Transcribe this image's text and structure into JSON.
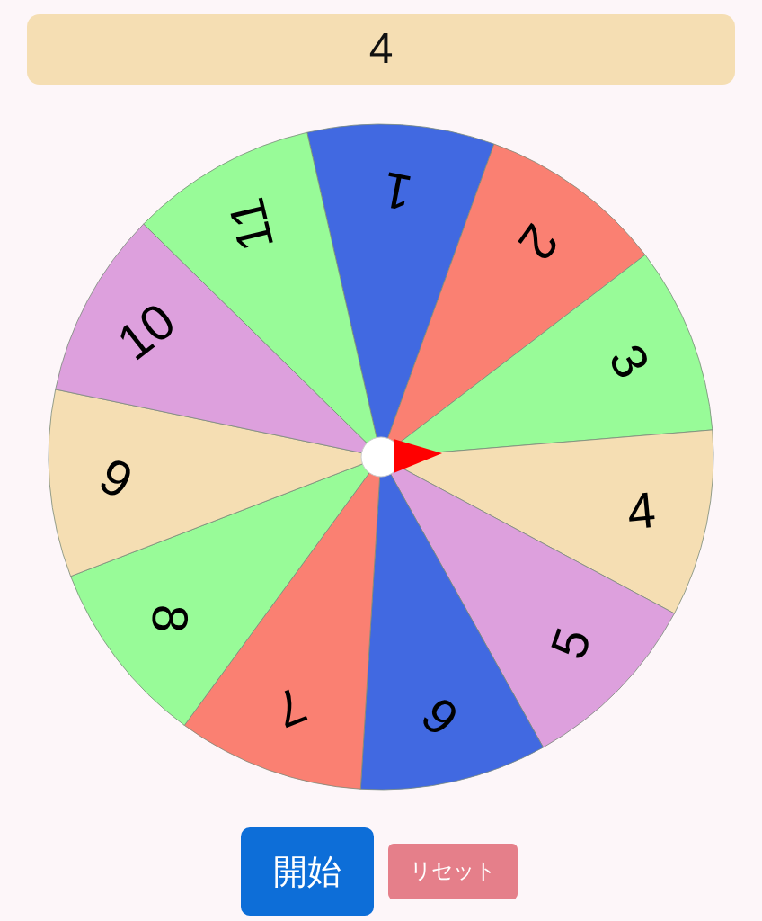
{
  "result": {
    "value": "4"
  },
  "wheel": {
    "segments": [
      {
        "label": "1",
        "color": "#4169e1"
      },
      {
        "label": "2",
        "color": "#fa8072"
      },
      {
        "label": "3",
        "color": "#98fb98"
      },
      {
        "label": "4",
        "color": "#f5deb3"
      },
      {
        "label": "5",
        "color": "#dda0dd"
      },
      {
        "label": "6",
        "color": "#4169e1"
      },
      {
        "label": "7",
        "color": "#fa8072"
      },
      {
        "label": "8",
        "color": "#98fb98"
      },
      {
        "label": "9",
        "color": "#f5deb3"
      },
      {
        "label": "10",
        "color": "#dda0dd"
      },
      {
        "label": "11",
        "color": "#98fb98"
      }
    ]
  },
  "buttons": [
    {
      "label": "開始",
      "kind": "primary"
    },
    {
      "label": "リセット",
      "kind": "reset"
    }
  ]
}
